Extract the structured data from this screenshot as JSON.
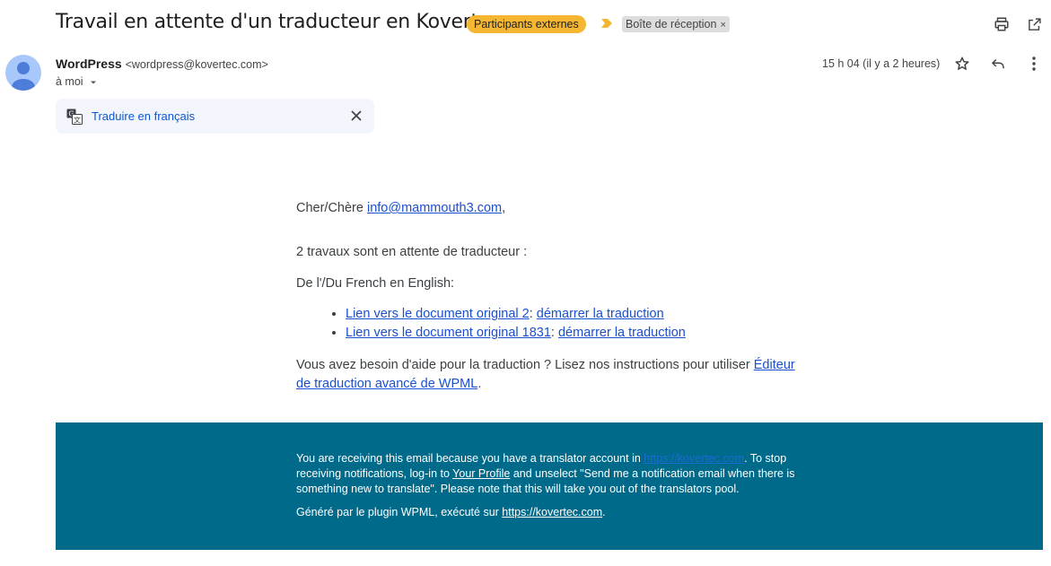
{
  "header": {
    "subject": "Travail en attente d'un traducteur en Kovertec",
    "label_external": "Participants externes",
    "label_inbox": "Boîte de réception",
    "label_inbox_close": "×",
    "colors": {
      "external_label": "#f5b731",
      "important_marker": "#f5b731",
      "inbox_label": "#dddddd"
    },
    "icons": {
      "print": "printer-icon",
      "open_new": "open-in-new-window-icon"
    }
  },
  "message": {
    "sender_name": "WordPress",
    "sender_email": "<wordpress@kovertec.com>",
    "recipient": "à moi",
    "date": "15 h 04 (il y a 2 heures)",
    "icons": {
      "star": "star-icon",
      "reply": "reply-icon",
      "more": "more-vertical-icon"
    }
  },
  "translate_bar": {
    "link": "Traduire en français",
    "icons": {
      "translate": "translate-icon",
      "close": "close-icon"
    }
  },
  "body": {
    "greeting_prefix": "Cher/Chère ",
    "greeting_email": "info@mammouth3.com",
    "greeting_suffix": ",",
    "jobs_count_text": "2 travaux sont en attente de traducteur :",
    "language_pair": "De l'/Du French en English:",
    "jobs": [
      {
        "doc_link": "Lien vers le document original 2",
        "separator": ": ",
        "action": "démarrer la traduction"
      },
      {
        "doc_link": "Lien vers le document original 1831",
        "separator": ": ",
        "action": "démarrer la traduction"
      }
    ],
    "help_prefix": "Vous avez besoin d'aide pour la traduction ? Lisez nos instructions pour utiliser ",
    "help_link": "Éditeur de traduction avancé de WPML",
    "help_suffix": "."
  },
  "footer": {
    "bg_color": "#006a8a",
    "p1_a": "You are receiving this email because you have a translator account in ",
    "p1_link": "https://kovertec.com",
    "p1_b": ". To stop receiving notifications, log-in to ",
    "p1_profile": "Your Profile",
    "p1_c": " and unselect \"Send me a notification email when there is something new to translate\". Please note that this will take you out of the translators pool.",
    "p2_a": "Généré par le plugin WPML, exécuté sur ",
    "p2_link": "https://kovertec.com",
    "p2_b": "."
  }
}
